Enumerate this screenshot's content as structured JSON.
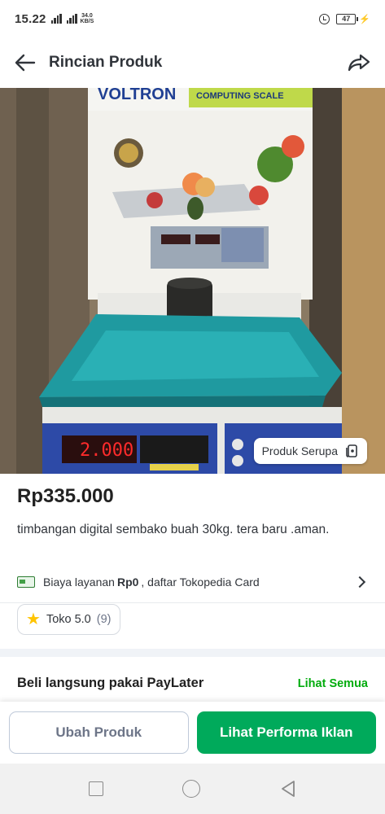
{
  "status": {
    "time": "15.22",
    "net_top": "34.0",
    "net_bottom": "KB/S",
    "battery": "47"
  },
  "header": {
    "title": "Rincian Produk"
  },
  "image": {
    "box_brand": "VOLTRON",
    "box_label": "COMPUTING SCALE",
    "display_value": "2.000",
    "similar_label": "Produk Serupa"
  },
  "product": {
    "price": "Rp335.000",
    "title": "timbangan digital sembako buah 30kg. tera baru .aman."
  },
  "service": {
    "prefix": "Biaya layanan",
    "amount": "Rp0",
    "suffix": ", daftar Tokopedia Card"
  },
  "rating": {
    "label": "Toko 5.0",
    "count": "(9)"
  },
  "paylater": {
    "title": "Beli langsung pakai PayLater",
    "link": "Lihat Semua"
  },
  "actions": {
    "secondary": "Ubah Produk",
    "primary": "Lihat Performa Iklan"
  },
  "colors": {
    "brand_green": "#00aa5b",
    "link_green": "#03ac0e",
    "star": "#ffc400"
  }
}
